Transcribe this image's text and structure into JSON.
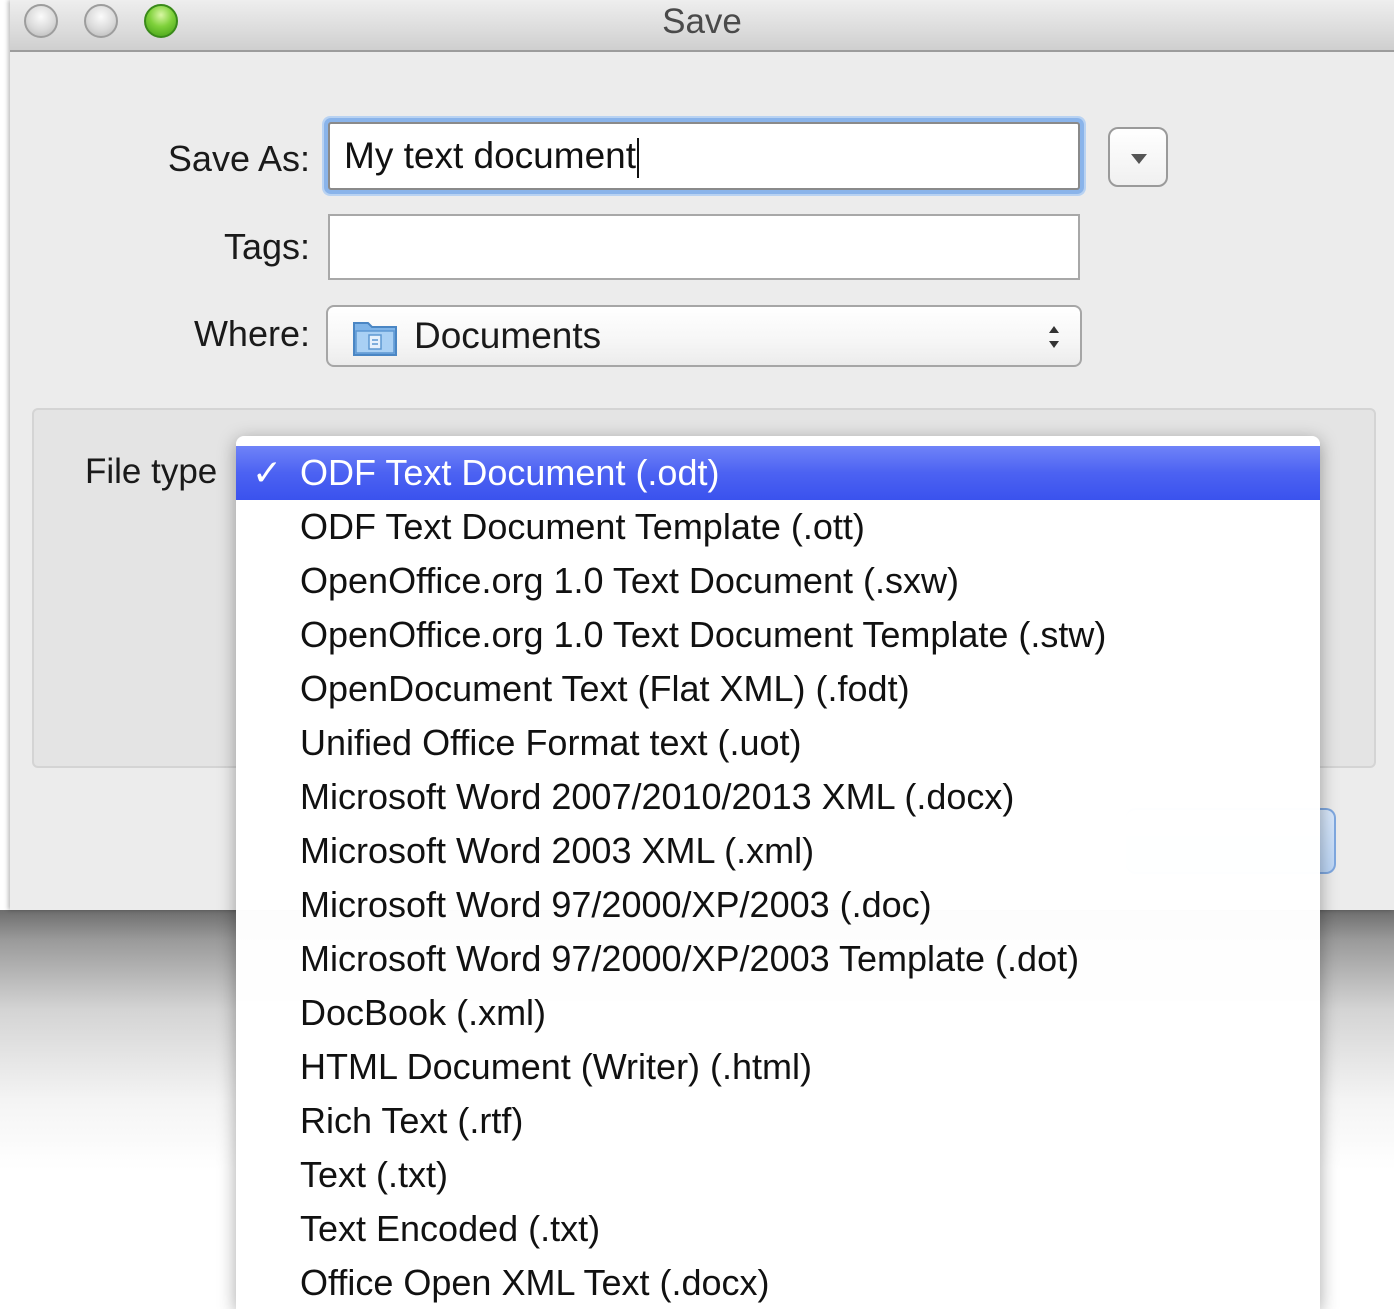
{
  "window": {
    "title": "Save",
    "controls": [
      "close-button",
      "minimize-button",
      "zoom-button"
    ]
  },
  "form": {
    "save_as_label": "Save As:",
    "save_as_value": "My text document",
    "tags_label": "Tags:",
    "tags_value": "",
    "where_label": "Where:",
    "where_value": "Documents",
    "file_type_label": "File type"
  },
  "file_type_menu": {
    "selected_index": 0,
    "check_mark": "✓",
    "items": [
      "ODF Text Document (.odt)",
      "ODF Text Document Template (.ott)",
      "OpenOffice.org 1.0 Text Document (.sxw)",
      "OpenOffice.org 1.0 Text Document Template (.stw)",
      "OpenDocument Text (Flat XML) (.fodt)",
      "Unified Office Format text (.uot)",
      "Microsoft Word 2007/2010/2013 XML (.docx)",
      "Microsoft Word 2003 XML (.xml)",
      "Microsoft Word 97/2000/XP/2003 (.doc)",
      "Microsoft Word 97/2000/XP/2003 Template (.dot)",
      "DocBook (.xml)",
      "HTML Document (Writer) (.html)",
      "Rich Text (.rtf)",
      "Text (.txt)",
      "Text Encoded (.txt)",
      "Office Open XML Text (.docx)"
    ]
  },
  "colors": {
    "selection": "#4c62f2",
    "focus_ring": "#8ab4ea",
    "dialog_bg": "#ececec"
  }
}
